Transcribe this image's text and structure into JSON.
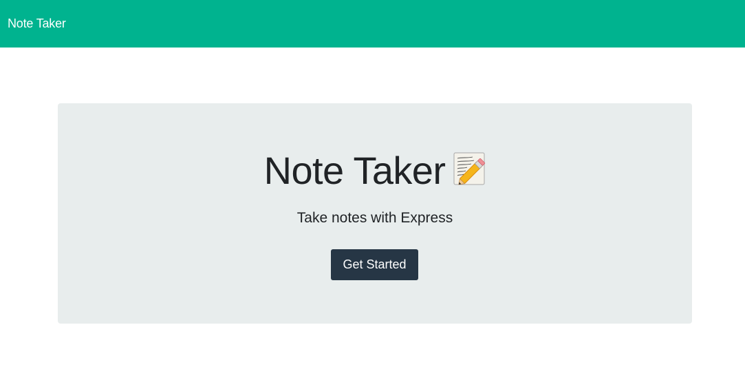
{
  "navbar": {
    "brand": "Note Taker"
  },
  "hero": {
    "title": "Note Taker",
    "title_icon": "memo-pencil-icon",
    "subtitle": "Take notes with Express",
    "button_label": "Get Started"
  },
  "colors": {
    "navbar": "#00b38f",
    "jumbotron": "#e8eded",
    "button": "#263645",
    "text": "#202326"
  }
}
